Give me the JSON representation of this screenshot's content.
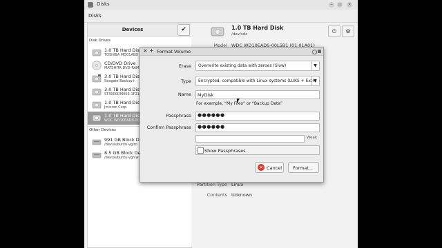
{
  "window": {
    "title": "Disks"
  },
  "menubar": {
    "item": "Disks"
  },
  "sidebar": {
    "header": "Devices",
    "disk_drives_label": "Disk Drives",
    "other_devices_label": "Other Devices",
    "drives": [
      {
        "name": "1.0 TB Hard Disk",
        "sub": "TOSHIBA MQ01ABD",
        "icon": "hard-disk-icon"
      },
      {
        "name": "CD/DVD Drive",
        "sub": "MATSHITA DVD-RAM",
        "icon": "optical-drive-icon"
      },
      {
        "name": "3.0 TB Hard Disk",
        "sub": "Seagate Backup+",
        "icon": "usb-disk-icon"
      },
      {
        "name": "3.0 TB Hard Disk",
        "sub": "ST3000DM003-1F216",
        "icon": "hard-disk-icon"
      },
      {
        "name": "1.0 TB Hard Disk",
        "sub": "Jmicron Corp.",
        "icon": "hard-disk-icon"
      },
      {
        "name": "1.0 TB Hard Disk",
        "sub": "WDC WD10EADS-00",
        "icon": "hard-disk-icon",
        "selected": true
      }
    ],
    "other_devices": [
      {
        "name": "991 GB Block Devic",
        "sub": "/dev/xubuntu-vg/ro",
        "icon": "block-device-icon"
      },
      {
        "name": "8.5 GB Block Devic",
        "sub": "/dev/xubuntu-vg/sw",
        "icon": "block-device-icon"
      }
    ]
  },
  "details": {
    "title": "1.0 TB Hard Disk",
    "path": "/dev/sdc",
    "model_label": "Model",
    "model_value": "WDC WD10EADS-00L5B1 (01.01A01)",
    "partition_type_label": "Partition Type",
    "partition_type_value": "Linux",
    "contents_label": "Contents",
    "contents_value": "Unknown"
  },
  "dialog": {
    "title": "Format Volume",
    "erase_label": "Erase",
    "erase_value": "Overwrite existing data with zeroes (Slow)",
    "type_label": "Type",
    "type_value": "Encrypted, compatible with Linux systems (LUKS + Ext4)",
    "name_label": "Name",
    "name_value": "MyDisk",
    "name_hint": "For example, “My Files” or “Backup Data”",
    "passphrase_label": "Passphrase",
    "passphrase_value": "●●●●●●",
    "confirm_label": "Confirm Passphrase",
    "confirm_value": "●●●●●●",
    "strength_label": "Weak",
    "show_passphrases_label": "Show Passphrases",
    "cancel_label": "Cancel",
    "format_label": "Format..."
  },
  "colors": {
    "accent": "#3a7fd0",
    "cancel_icon": "#d63b2f"
  }
}
